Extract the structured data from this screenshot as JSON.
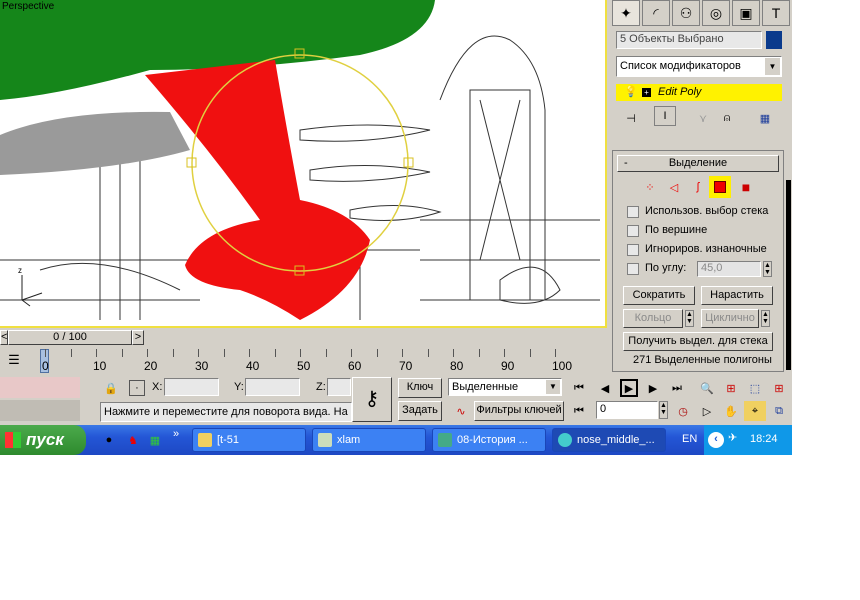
{
  "viewport": {
    "label": "Perspective"
  },
  "panel": {
    "selection_count": "5 Объекты Выбрано",
    "object_color": "#0a3a8c",
    "modifier_list": "Список модификаторов",
    "stack_item": "Edit Poly",
    "rollout_title": "Выделение",
    "rollout_toggle": "-",
    "checkboxes": [
      {
        "label": "Использов. выбор стека",
        "checked": false
      },
      {
        "label": "По вершине",
        "checked": false
      },
      {
        "label": "Игнориров. изнаночные",
        "checked": false
      },
      {
        "label": "По углу:",
        "checked": false
      }
    ],
    "angle_value": "45,0",
    "shrink": "Сократить",
    "grow": "Нарастить",
    "ring": "Кольцо",
    "loop": "Циклично",
    "get_stack_selection": "Получить выдел. для стека",
    "status": "271 Выделенные полигоны"
  },
  "timeline": {
    "frame_display": "0 / 100",
    "prev": "<",
    "next": ">",
    "ticks": [
      "0",
      "10",
      "20",
      "30",
      "40",
      "50",
      "60",
      "70",
      "80",
      "90",
      "100"
    ],
    "current_frame": 0
  },
  "status_bar": {
    "x_label": "X:",
    "y_label": "Y:",
    "z_label": "Z:",
    "prompt": "Нажмите и переместите для поворота вида.  На",
    "key_button": "Ключ",
    "set_button": "Задать",
    "key_mode": "Выделенные",
    "key_filters": "Фильтры ключей",
    "frame_field": "0"
  },
  "taskbar": {
    "start": "пуск",
    "overflow": "»",
    "tasks": [
      "[t-51",
      "xlam",
      "08-История ...",
      "nose_middle_..."
    ],
    "language": "EN",
    "clock": "18:24"
  }
}
